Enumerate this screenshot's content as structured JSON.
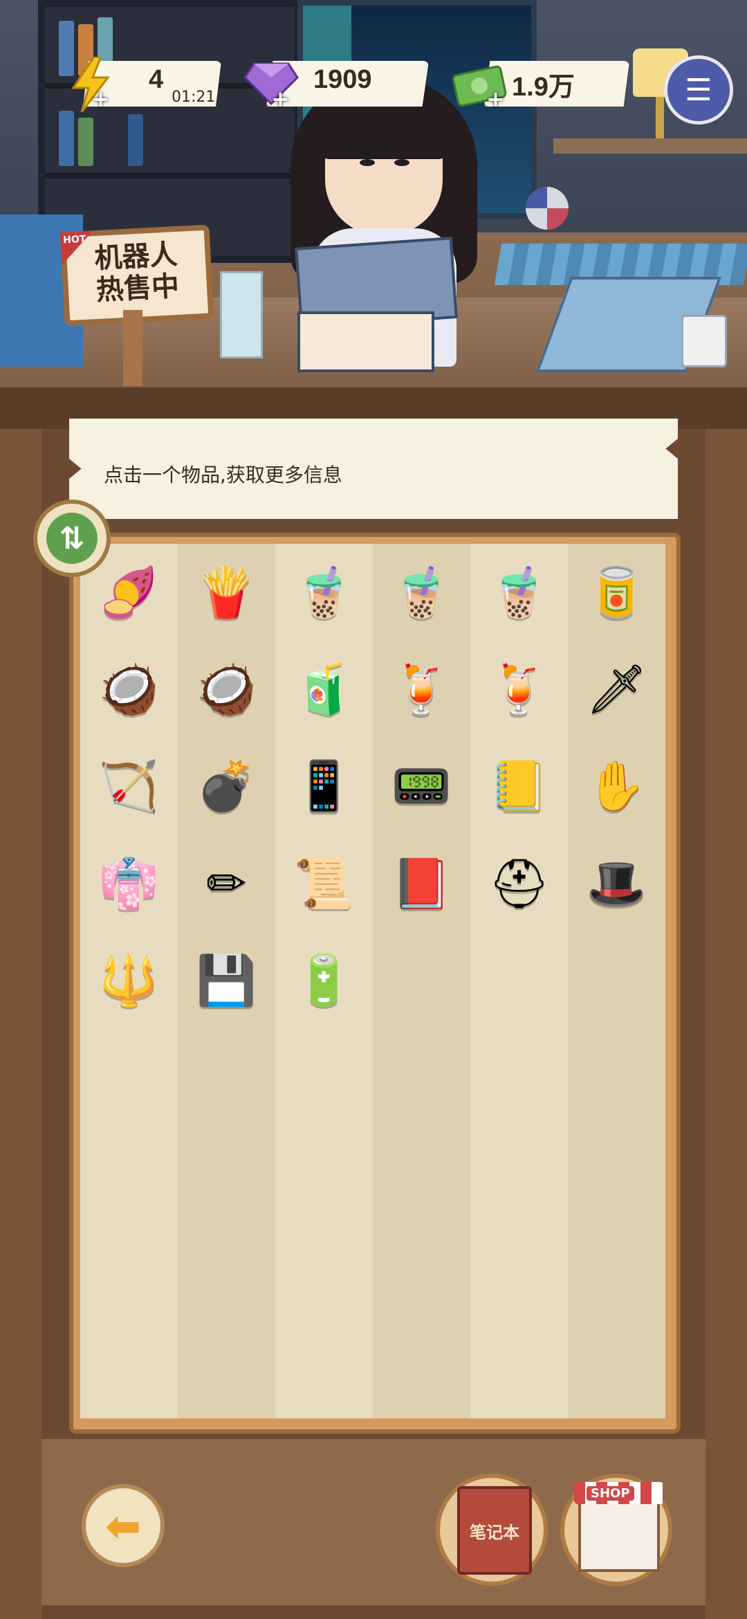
{
  "hud": {
    "energy": {
      "value": "4",
      "timer": "01:21",
      "icon": "lightning-icon"
    },
    "gems": {
      "value": "1909",
      "icon": "gem-icon"
    },
    "cash": {
      "value": "1.9万",
      "icon": "cash-icon"
    },
    "plus_symbol": "+"
  },
  "sign": {
    "badge": "HOT",
    "line1": "机器人",
    "line2": "热售中"
  },
  "info": {
    "text": "点击一个物品,获取更多信息"
  },
  "inventory": {
    "items": [
      {
        "name": "roasted-sweet-potato",
        "glyph": "🍠"
      },
      {
        "name": "french-fries",
        "glyph": "🍟"
      },
      {
        "name": "hi-tea-bubble-tea",
        "glyph": "🧋"
      },
      {
        "name": "hi-tea-bubble-tea",
        "glyph": "🧋"
      },
      {
        "name": "hi-tea-bubble-tea",
        "glyph": "🧋"
      },
      {
        "name": "coconut-juice-can",
        "glyph": "🥫"
      },
      {
        "name": "coconut-drink",
        "glyph": "🥥"
      },
      {
        "name": "coconut-drink",
        "glyph": "🥥"
      },
      {
        "name": "orange-juice-jar",
        "glyph": "🧃"
      },
      {
        "name": "orange-tea-pitcher",
        "glyph": "🍹"
      },
      {
        "name": "orange-tea-pitcher",
        "glyph": "🍹"
      },
      {
        "name": "short-sword",
        "glyph": "🗡"
      },
      {
        "name": "crossbow",
        "glyph": "🏹"
      },
      {
        "name": "cannon",
        "glyph": "💣"
      },
      {
        "name": "flip-phone",
        "glyph": "📱"
      },
      {
        "name": "tablet",
        "glyph": "📟"
      },
      {
        "name": "golden-book",
        "glyph": "📒"
      },
      {
        "name": "buddha-hand",
        "glyph": "✋"
      },
      {
        "name": "straw-hat-cloak",
        "glyph": "👘"
      },
      {
        "name": "pencil",
        "glyph": "✏"
      },
      {
        "name": "paper-scroll",
        "glyph": "📜"
      },
      {
        "name": "red-book",
        "glyph": "📕"
      },
      {
        "name": "golden-helmet",
        "glyph": "⛑"
      },
      {
        "name": "wizard-hat",
        "glyph": "🎩"
      },
      {
        "name": "magic-staff",
        "glyph": "🔱"
      },
      {
        "name": "memory-card",
        "glyph": "💾"
      },
      {
        "name": "capsule-device",
        "glyph": "🔋"
      }
    ],
    "total_slots": 54
  },
  "bottom": {
    "back_icon": "back-arrow-icon",
    "notebook_label": "笔记本",
    "shop_label": "SHOP"
  },
  "colors": {
    "accent": "#5fa04e",
    "panel": "#f7f1e1",
    "frame": "#d59a5d",
    "wood": "#6c4a32"
  }
}
